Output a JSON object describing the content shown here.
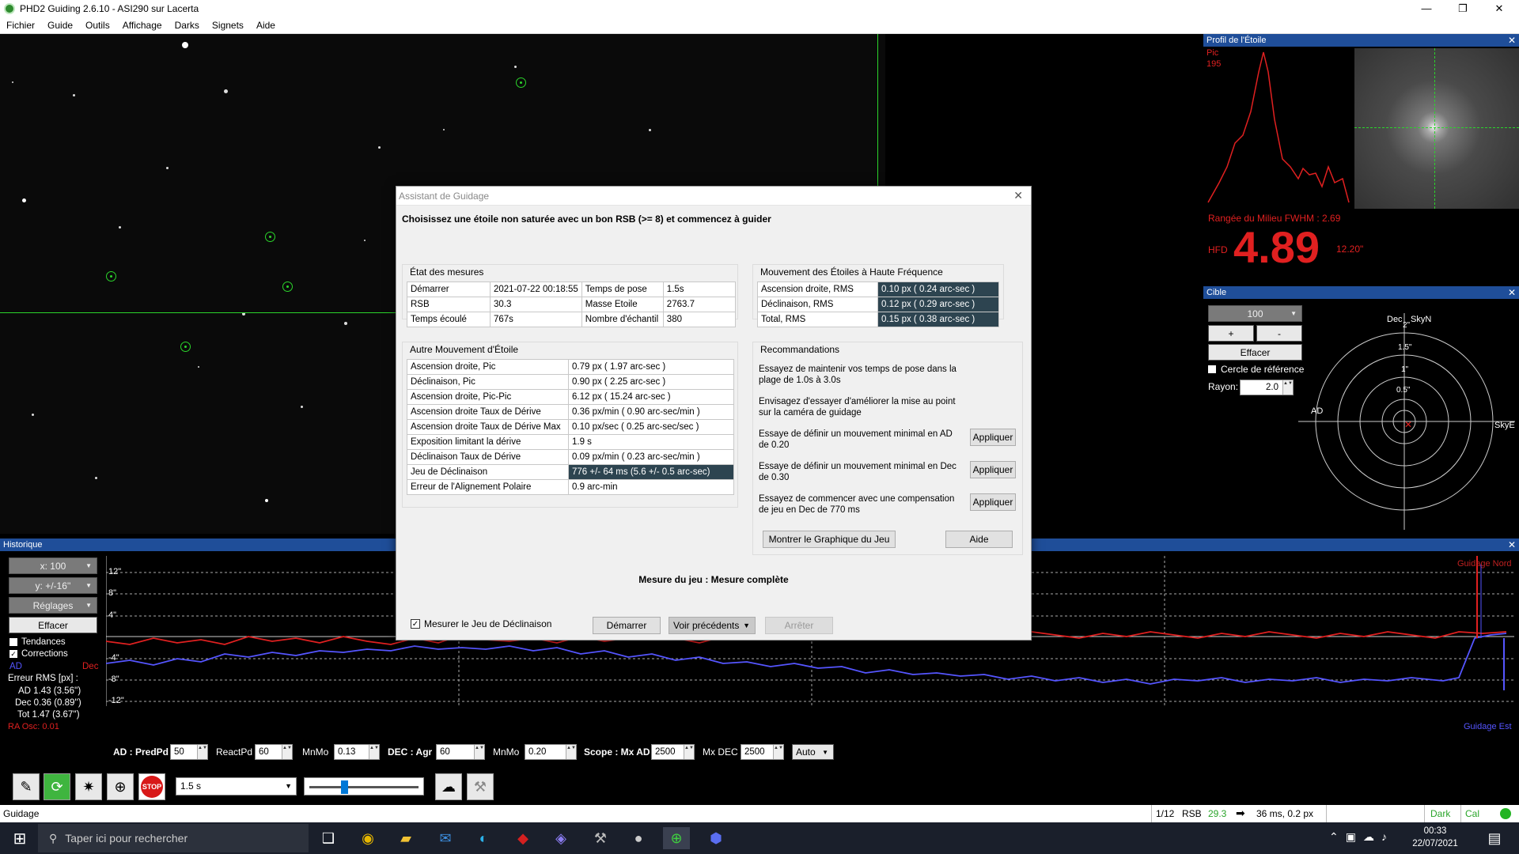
{
  "window": {
    "title": "PHD2 Guiding 2.6.10 - ASI290 sur Lacerta"
  },
  "menu": [
    "Fichier",
    "Guide",
    "Outils",
    "Affichage",
    "Darks",
    "Signets",
    "Aide"
  ],
  "profil": {
    "title": "Profil de l'Étoile",
    "pic_label": "Pic",
    "pic_value": "195",
    "fwhm_text": "Rangée du Milieu FWHM : 2.69",
    "hfd_label": "HFD",
    "hfd_value": "4.89",
    "hfd_arcsec": "12.20\""
  },
  "cible": {
    "title": "Cible",
    "scale_value": "100",
    "plus": "+",
    "minus": "-",
    "clear": "Effacer",
    "ref_circle": "Cercle de référence",
    "radius_label": "Rayon:",
    "radius_value": "2.0",
    "labels": {
      "dec": "Dec",
      "skyn": "SkyN",
      "ad": "AD",
      "skye": "SkyE",
      "r2": "2\"",
      "r15": "1.5\"",
      "r1": "1\"",
      "r05": "0.5\""
    }
  },
  "historique": {
    "title": "Historique",
    "x_scale": "x: 100",
    "y_scale": "y: +/-16''",
    "settings": "Réglages",
    "clear": "Effacer",
    "trends": "Tendances",
    "corrections": "Corrections",
    "ad_label": "AD",
    "dec_label": "Dec",
    "rms_title": "Erreur RMS [px] :",
    "rms_ad": "AD 1.43 (3.56'')",
    "rms_dec": "Dec 0.36 (0.89'')",
    "rms_tot": "Tot 1.47 (3.67'')",
    "ra_osc": "RA Osc: 0.01",
    "y_ticks": [
      "12\"",
      "8\"",
      "4\"",
      "-4\"",
      "-8\"",
      "-12\""
    ],
    "guide_north": "Guidage Nord",
    "guide_east": "Guidage Est"
  },
  "controls": {
    "ad_predpd": "AD : PredPd",
    "ad_predpd_val": "50",
    "reactpd": "ReactPd",
    "reactpd_val": "60",
    "mnmo1": "MnMo",
    "mnmo1_val": "0.13",
    "dec_agr": "DEC : Agr",
    "dec_agr_val": "60",
    "mnmo2": "MnMo",
    "mnmo2_val": "0.20",
    "scope_mxad": "Scope : Mx AD",
    "scope_mxad_val": "2500",
    "mxdec": "Mx DEC",
    "mxdec_val": "2500",
    "auto": "Auto"
  },
  "toolbar": {
    "exposure": "1.5 s"
  },
  "status": {
    "mode": "Guidage",
    "frame": "1/12",
    "rsb_label": "RSB",
    "rsb_value": "29.3",
    "pulse": "36 ms, 0.2 px",
    "dark": "Dark",
    "cal": "Cal"
  },
  "dialog": {
    "title": "Assistant de Guidage",
    "instruction": "Choisissez une étoile non saturée avec un bon RSB (>= 8) et commencez à guider",
    "etat_title": "État des mesures",
    "etat_rows": [
      [
        "Démarrer",
        "2021-07-22 00:18:55",
        "Temps de pose",
        "1.5s"
      ],
      [
        "RSB",
        "30.3",
        "Masse Etoile",
        "2763.7"
      ],
      [
        "Temps écoulé",
        "767s",
        "Nombre d'échantil",
        "380"
      ]
    ],
    "hf_title": "Mouvement des Étoiles à Haute Fréquence",
    "hf_rows": [
      [
        "Ascension droite, RMS",
        "0.10 px ( 0.24 arc-sec )"
      ],
      [
        "Déclinaison, RMS",
        "0.12 px ( 0.29 arc-sec )"
      ],
      [
        "Total, RMS",
        "0.15 px ( 0.38 arc-sec )"
      ]
    ],
    "autre_title": "Autre Mouvement d'Étoile",
    "autre_rows": [
      [
        "Ascension droite, Pic",
        "0.79 px ( 1.97 arc-sec )"
      ],
      [
        "Déclinaison, Pic",
        "0.90 px ( 2.25 arc-sec )"
      ],
      [
        "Ascension droite, Pic-Pic",
        "6.12 px ( 15.24 arc-sec )"
      ],
      [
        "Ascension droite Taux de Dérive",
        "0.36 px/min ( 0.90 arc-sec/min )"
      ],
      [
        "Ascension droite Taux de Dérive Max",
        "0.10 px/sec ( 0.25 arc-sec/sec )"
      ],
      [
        "Exposition limitant la dérive",
        "1.9 s"
      ],
      [
        "Déclinaison Taux de Dérive",
        "0.09 px/min ( 0.23 arc-sec/min )"
      ],
      [
        "Jeu de Déclinaison",
        "776 +/- 64 ms (5.6 +/- 0.5 arc-sec)"
      ],
      [
        "Erreur de l'Alignement Polaire",
        "0.9 arc-min"
      ]
    ],
    "reco_title": "Recommandations",
    "reco_1": "Essayez de maintenir vos temps de pose dans la plage de 1.0s à 3.0s",
    "reco_2": "Envisagez d'essayer d'améliorer la mise au point sur la caméra de guidage",
    "reco_3": "Essaye de définir un mouvement minimal en AD de 0.20",
    "reco_4": "Essaye de définir un mouvement minimal en Dec de 0.30",
    "reco_5": "Essayez de commencer avec une compensation de jeu en Dec de 770 ms",
    "apply": "Appliquer",
    "show_graph": "Montrer le Graphique du Jeu",
    "help": "Aide",
    "status": "Mesure du jeu : Mesure complète",
    "measure_backlash": "Mesurer le Jeu de Déclinaison",
    "start": "Démarrer",
    "previous": "Voir précédents",
    "stop": "Arrêter"
  },
  "taskbar": {
    "search_placeholder": "Taper ici pour rechercher",
    "time": "00:33",
    "date": "22/07/2021"
  }
}
